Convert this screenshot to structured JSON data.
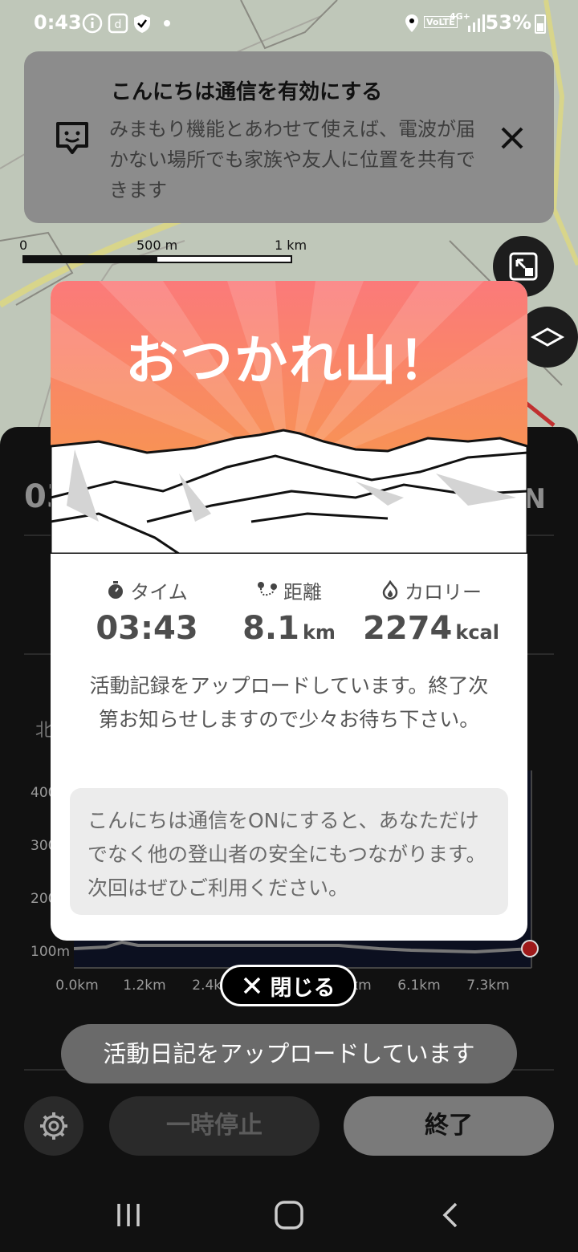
{
  "status_bar": {
    "time": "0:43",
    "battery": "53%",
    "icons": [
      "info-icon",
      "d-icon",
      "shield-icon",
      "dot-icon",
      "location-icon",
      "volte-icon",
      "4g-icon",
      "signal-icon",
      "battery-icon"
    ],
    "volte_label": "VoLTE",
    "network_label": "4G+"
  },
  "notice": {
    "title": "こんにちは通信を有効にする",
    "body": "みまもり機能とあわせて使えば、電波が届かない場所でも家族や友人に位置を共有できます"
  },
  "map_scale": {
    "t0": "0",
    "t1": "500 m",
    "t2": "1 km"
  },
  "panel": {
    "big_time": "03",
    "compass": "N",
    "north_label": "北"
  },
  "elevation": {
    "y_labels": [
      "400",
      "300",
      "200",
      "100m"
    ],
    "x_labels": [
      "0.0km",
      "1.2km",
      "2.4km",
      "4.9km",
      "6.1km",
      "7.3km"
    ]
  },
  "modal": {
    "headline": "おつかれ山！",
    "stats": [
      {
        "label": "タイム",
        "value": "03:43",
        "unit": ""
      },
      {
        "label": "距離",
        "value": "8.1",
        "unit": "km"
      },
      {
        "label": "カロリー",
        "value": "2274",
        "unit": "kcal"
      }
    ],
    "message": "活動記録をアップロードしています。終了次第お知らせしますので少々お待ち下さい。",
    "info": "こんにちは通信をONにすると、あなただけでなく他の登山者の安全にもつながります。次回はぜひご利用ください。",
    "hero_colors": {
      "top": "#f97a7a",
      "bottom": "#f39a3b"
    }
  },
  "close_button": {
    "label": "閉じる"
  },
  "toast": "活動日記をアップロードしています",
  "controls": {
    "pause": "一時停止",
    "end": "終了"
  },
  "colors": {
    "accent": "#f38a3c",
    "panel": "#111111",
    "modal_bg": "#ffffff"
  }
}
